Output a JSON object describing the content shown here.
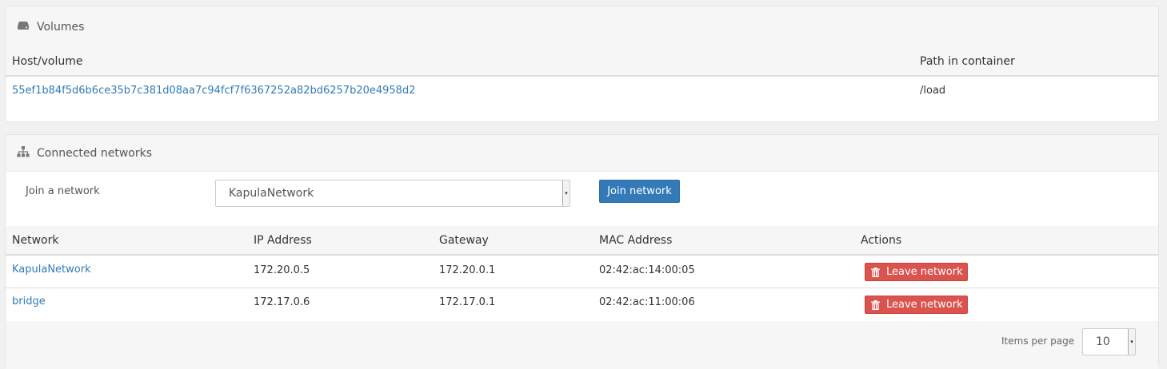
{
  "volumes": {
    "title": "Volumes",
    "columns": {
      "host": "Host/volume",
      "path": "Path in container"
    },
    "rows": [
      {
        "host": "55ef1b84f5d6b6ce35b7c381d08aa7c94fcf7f6367252a82bd6257b20e4958d2",
        "path": "/load"
      }
    ]
  },
  "networks": {
    "title": "Connected networks",
    "join_label": "Join a network",
    "join_select_value": "KapulaNetwork",
    "join_button": "Join network",
    "columns": {
      "network": "Network",
      "ip": "IP Address",
      "gateway": "Gateway",
      "mac": "MAC Address",
      "actions": "Actions"
    },
    "rows": [
      {
        "network": "KapulaNetwork",
        "ip": "172.20.0.5",
        "gateway": "172.20.0.1",
        "mac": "02:42:ac:14:00:05",
        "action": "Leave network"
      },
      {
        "network": "bridge",
        "ip": "172.17.0.6",
        "gateway": "172.17.0.1",
        "mac": "02:42:ac:11:00:06",
        "action": "Leave network"
      }
    ],
    "pagination": {
      "label": "Items per page",
      "value": "10"
    }
  },
  "colors": {
    "link": "#337ab7",
    "primary": "#337ab7",
    "danger": "#d9534f"
  },
  "icons": {
    "volumes": "hdd-icon",
    "networks": "sitemap-icon",
    "leave": "trash-icon"
  }
}
